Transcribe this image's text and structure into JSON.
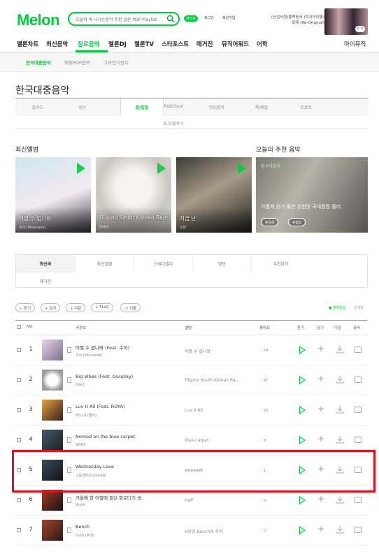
{
  "header": {
    "logo": "Melon",
    "search_placeholder": "오늘의 바 나나는음악 추천 실론 POP Playlist",
    "live_badge": "라이브",
    "links": [
      "로그인",
      "회원가입"
    ],
    "banner_text": "(신입사원)블랙핑크 (여자아이돌) 로제 (Re-Original)",
    "banner_nav": "< >"
  },
  "gnb": {
    "items": [
      "멜론차트",
      "최신음악",
      "장르음악",
      "멜론DJ",
      "멜론TV",
      "스타포스트",
      "매거진",
      "뮤직어워드",
      "어학"
    ],
    "right": "마이뮤직"
  },
  "subnav": {
    "items": [
      "한국대중음악",
      "해외POP음악",
      "그외인기장르"
    ]
  },
  "page_title": "한국대중음악",
  "genres": [
    "발라드",
    "댄스",
    "랩/힙합",
    "R&B/Soul",
    "인디음악",
    "록/메탈",
    "트로트",
    "포크/블루스"
  ],
  "sections": {
    "new_albums": "최신앨범",
    "recommend": "오늘의 추천 음악"
  },
  "albums": [
    {
      "title": "어쩔 수 없나봐",
      "artist": "조씨 (Moonwok)"
    },
    {
      "title": "Filipino South Korean Rapsta...",
      "artist": "Dok2"
    },
    {
      "title": "지금 난",
      "artist": "오반"
    }
  ],
  "recommend": {
    "badge": "멍구의플리",
    "desc": "가볍게 듣기 좋은 쏜한맛 국내힙합 플리",
    "tags": [
      "#감성",
      "#힙합"
    ]
  },
  "tabs": [
    "최신곡",
    "최신앨범",
    "스테디셀러",
    "명반",
    "추천음악",
    "매거진"
  ],
  "actions": [
    "듣기",
    "담기",
    "다운",
    "FLAC",
    "선물"
  ],
  "sort": [
    "발매일순",
    "인기순"
  ],
  "table_head": {
    "cb": "",
    "no": "NO",
    "song": "곡정보",
    "album": "앨범",
    "like": "좋아요",
    "listen": "듣기",
    "add": "담기",
    "down": "다운",
    "mv": "뮤비"
  },
  "songs": [
    {
      "rank": "1",
      "title": "어쩔 수 없나봐 (Feat. 수아)",
      "artist": "조씨 (Moonwok)",
      "album": "어쩔 수 없나봐",
      "likes": "54"
    },
    {
      "rank": "2",
      "title": "Big Vibes (Feat. Gunplay)",
      "artist": "Dok2",
      "album": "Filipino South Korean Ra...",
      "likes": "87"
    },
    {
      "rank": "3",
      "title": "Luv It All (Feat. ROYA)",
      "artist": "YELLA (옐라)",
      "album": "Luv It All",
      "likes": "22"
    },
    {
      "rank": "4",
      "title": "Nomad on the blue carpet",
      "artist": "SMDK",
      "album": "Blue carpet",
      "likes": "9"
    },
    {
      "rank": "5",
      "title": "Wednesday Love",
      "artist": "고등랩퍼(Coolslaw)",
      "album": "weeeeek",
      "likes": "1"
    },
    {
      "rank": "6",
      "title": "거울에 한 이별에 들던 헝로다기 생..",
      "artist": "Yooth",
      "album": "Half",
      "likes": "2"
    },
    {
      "rank": "7",
      "title": "Bench",
      "artist": "HuiN (후엔)",
      "album": "H모양 Bench의 추억",
      "likes": "0"
    }
  ],
  "colors": {
    "brand": "#00cd3c",
    "highlight": "#e0121b"
  }
}
